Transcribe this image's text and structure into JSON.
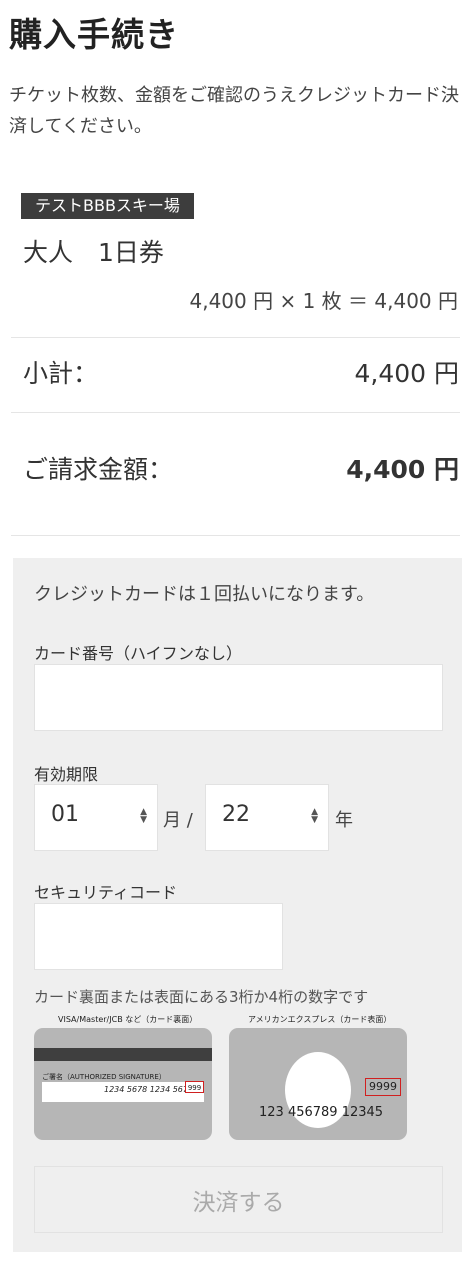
{
  "page": {
    "title": "購入手続き",
    "intro": "チケット枚数、金額をご確認のうえクレジットカード決済してください。"
  },
  "order": {
    "resort_tag": "テストBBBスキー場",
    "ticket_name": "大人　1日券",
    "price_line": "4,400 円 × 1 枚 ＝ 4,400 円",
    "subtotal_label": "小計：",
    "subtotal_value": "4,400 円",
    "total_label": "ご請求金額：",
    "total_value": "4,400 円"
  },
  "payment": {
    "note": "クレジットカードは１回払いになります。",
    "card_number_label": "カード番号（ハイフンなし）",
    "card_number_value": "",
    "expiry_label": "有効期限",
    "month_value": "01",
    "month_unit": "月 /",
    "year_value": "22",
    "year_unit": "年",
    "security_label": "セキュリティコード",
    "security_value": "",
    "security_hint": "カード裏面または表面にある3桁か4桁の数字です",
    "card_back_caption": "VISA/Master/JCB など（カード裏面）",
    "card_back_sign_label": "ご署名（AUTHORIZED SIGNATURE）",
    "card_back_number": "1234 5678 1234 5678",
    "card_back_cvc": "999",
    "amex_caption": "アメリカンエクスプレス（カード表面）",
    "amex_code": "9999",
    "amex_number": "123 456789 12345",
    "submit_label": "決済する"
  },
  "colors": {
    "tag_bg": "#3d3d3d",
    "panel_bg": "#efefef",
    "highlight": "#d02020"
  }
}
